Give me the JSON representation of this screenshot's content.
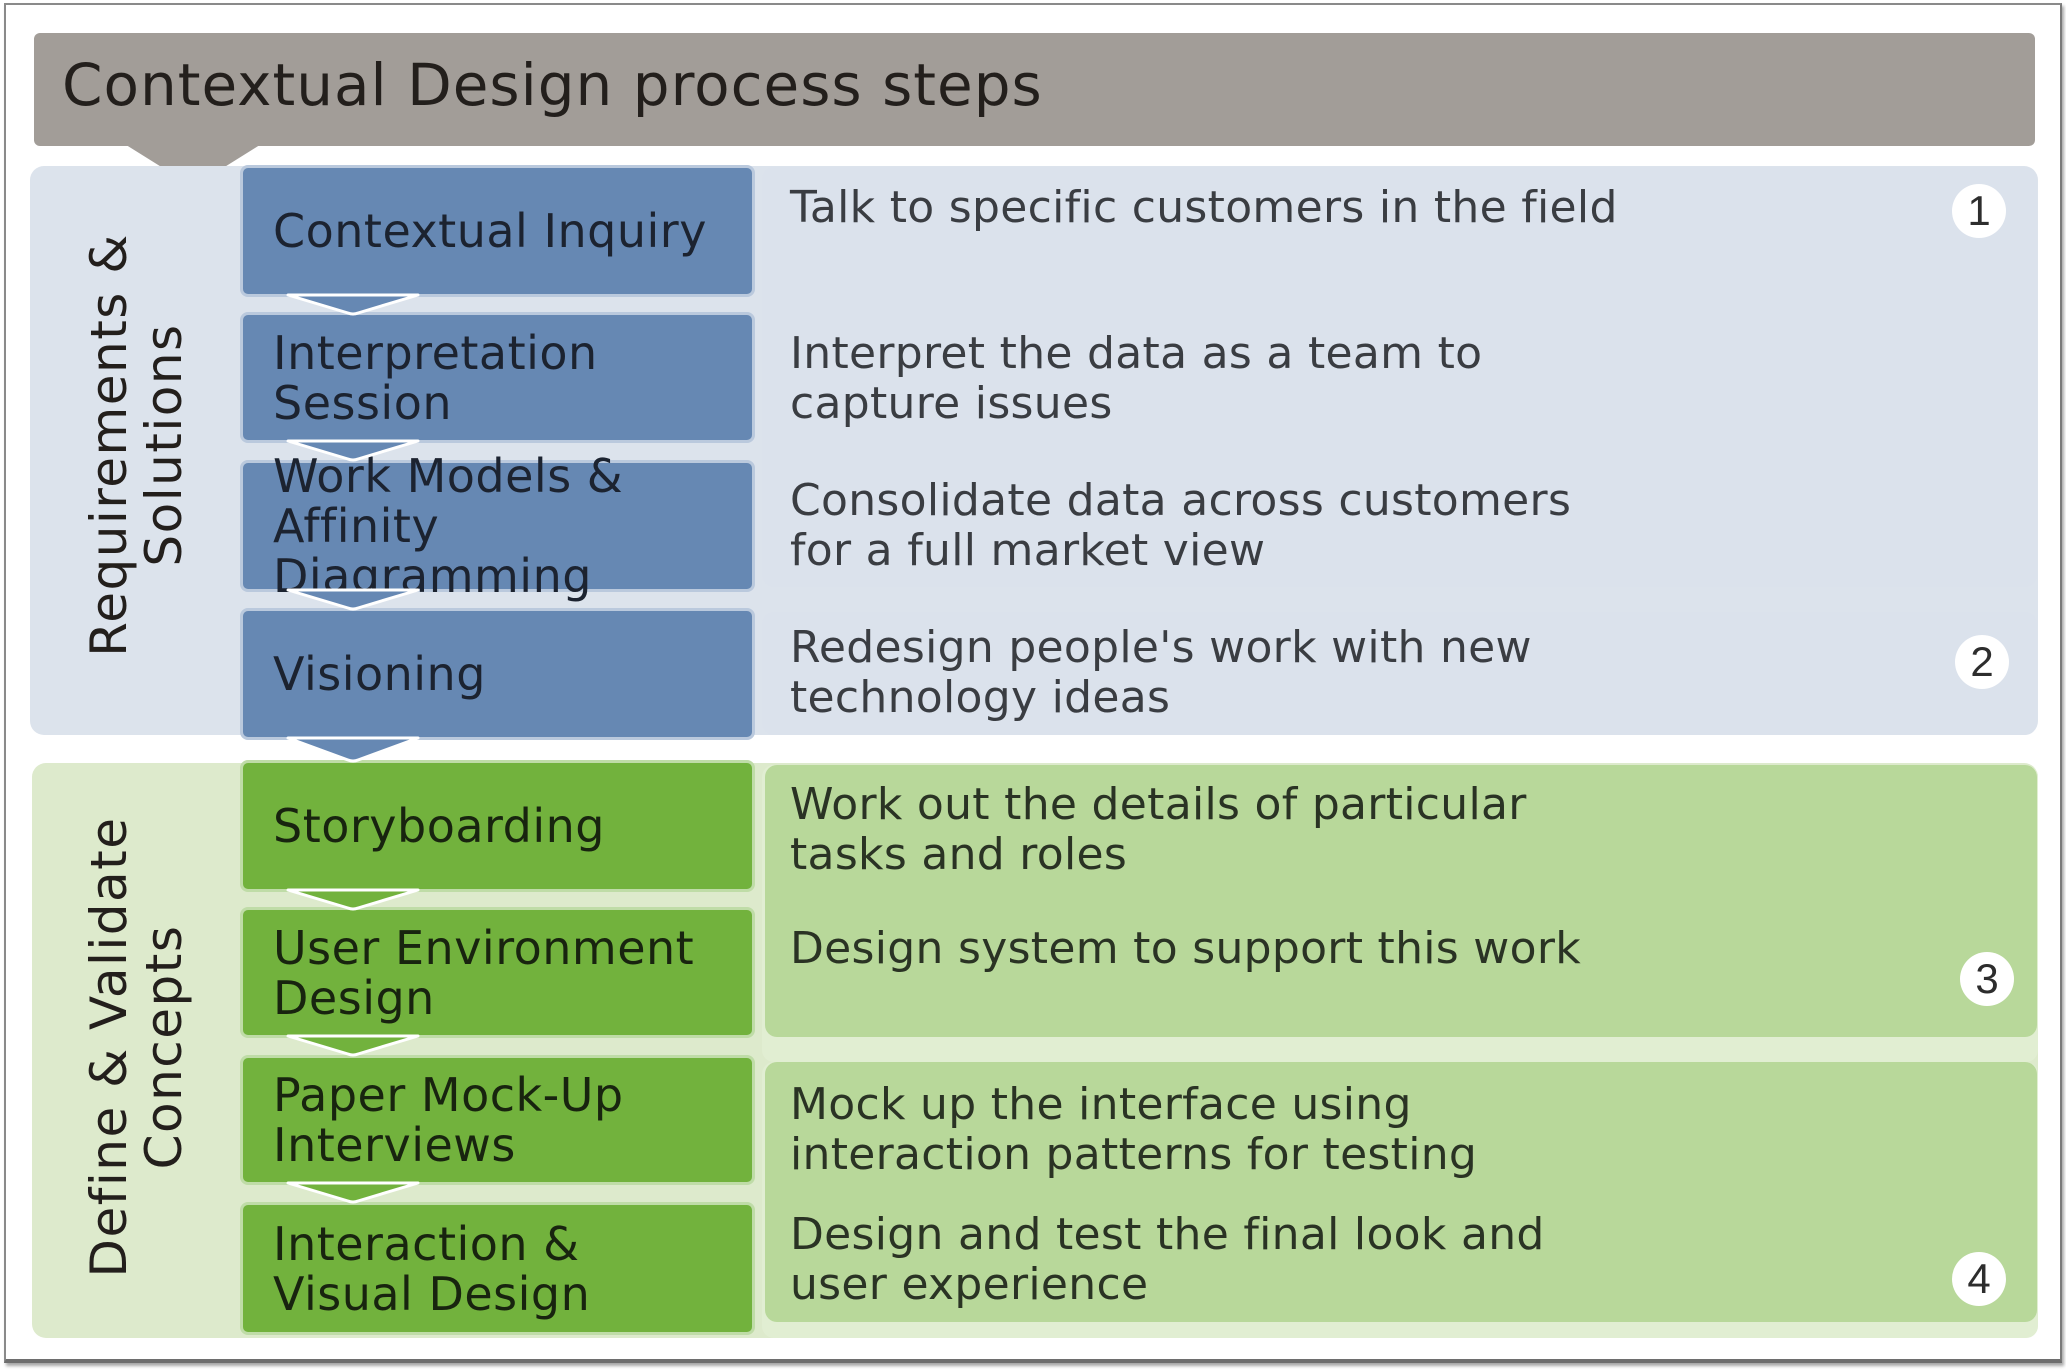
{
  "title": "Contextual Design process steps",
  "colors": {
    "header": "#a29d98",
    "blue_step": "#6688b3",
    "green_step": "#72b23d",
    "blue_panel": "#dbe2ec",
    "green_panel": "#b8d89a"
  },
  "phases": [
    {
      "id": "requirements",
      "label_lines": [
        "Requirements &",
        "Solutions"
      ],
      "color": "blue"
    },
    {
      "id": "define",
      "label_lines": [
        "Define & Validate",
        "Concepts"
      ],
      "color": "green"
    }
  ],
  "steps": [
    {
      "label": "Contextual Inquiry",
      "phase": "requirements",
      "description": "Talk to specific customers in the field"
    },
    {
      "label": "Interpretation\nSession",
      "phase": "requirements",
      "description": "Interpret the data as a team to\ncapture issues"
    },
    {
      "label": "Work Models &\nAffinity Diagramming",
      "phase": "requirements",
      "description": "Consolidate data across customers\nfor a full market view"
    },
    {
      "label": "Visioning",
      "phase": "requirements",
      "description": "Redesign people's work with new\ntechnology ideas"
    },
    {
      "label": "Storyboarding",
      "phase": "define",
      "description": "Work out the details of particular\ntasks and roles"
    },
    {
      "label": "User Environment\nDesign",
      "phase": "define",
      "description": "Design system to support this work"
    },
    {
      "label": "Paper Mock-Up\nInterviews",
      "phase": "define",
      "description": "Mock up the interface using\ninteraction patterns for testing"
    },
    {
      "label": "Interaction &\nVisual Design",
      "phase": "define",
      "description": "Design and test the final look and\nuser experience"
    }
  ],
  "groups": [
    {
      "number": "1",
      "steps": [
        0,
        1,
        2
      ]
    },
    {
      "number": "2",
      "steps": [
        3
      ]
    },
    {
      "number": "3",
      "steps": [
        4,
        5
      ]
    },
    {
      "number": "4",
      "steps": [
        6,
        7
      ]
    }
  ]
}
